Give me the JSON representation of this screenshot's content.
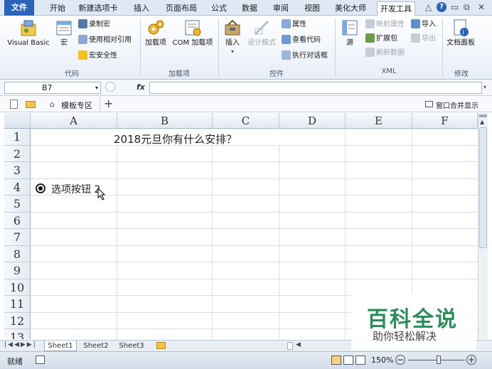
{
  "ribbon_tabs": [
    "文件",
    "开始",
    "新建选项卡",
    "插入",
    "页面布局",
    "公式",
    "数据",
    "审阅",
    "视图",
    "美化大师",
    "开发工具"
  ],
  "window_controls": {
    "collapse": "△",
    "help": "?",
    "minimize": "▭",
    "restore": "⧉",
    "close": "✕"
  },
  "groups": {
    "code": {
      "label": "代码",
      "visual_basic": "Visual Basic",
      "macros": "宏",
      "record_macro": "录制宏",
      "relative_ref": "使用相对引用",
      "macro_security": "宏安全性"
    },
    "addins": {
      "label": "加载项",
      "addins": "加载项",
      "com_addins": "COM 加载项"
    },
    "controls": {
      "label": "控件",
      "insert": "插入",
      "design_mode": "设计模式",
      "properties": "属性",
      "view_code": "查看代码",
      "run_dialog": "执行对话框"
    },
    "xml": {
      "label": "XML",
      "source": "源",
      "map_props": "映射属性",
      "expansion": "扩展包",
      "refresh": "刷新数据",
      "import": "导入",
      "export": "导出"
    },
    "modify": {
      "label": "修改",
      "doc_panel": "文档面板"
    }
  },
  "formula_bar": {
    "name_box": "B7",
    "fx": "fx",
    "formula": ""
  },
  "template_bar": {
    "template_zone": "模板专区",
    "add": "+",
    "merge_window": "窗口合并显示"
  },
  "columns": [
    "A",
    "B",
    "C",
    "D",
    "E",
    "F"
  ],
  "rows": [
    "1",
    "2",
    "3",
    "4",
    "5",
    "6",
    "7",
    "8",
    "9",
    "10",
    "11",
    "12",
    "13"
  ],
  "cells": {
    "title": "2018元旦你有什么安排？"
  },
  "radio_button": {
    "label": "选项按钮 2"
  },
  "sheets": [
    "Sheet1",
    "Sheet2",
    "Sheet3"
  ],
  "status": {
    "ready": "就绪",
    "zoom": "150%",
    "zoom_minus": "−",
    "zoom_plus": "+"
  },
  "watermark": {
    "title": "百科全说",
    "subtitle": "助你轻松解决"
  }
}
